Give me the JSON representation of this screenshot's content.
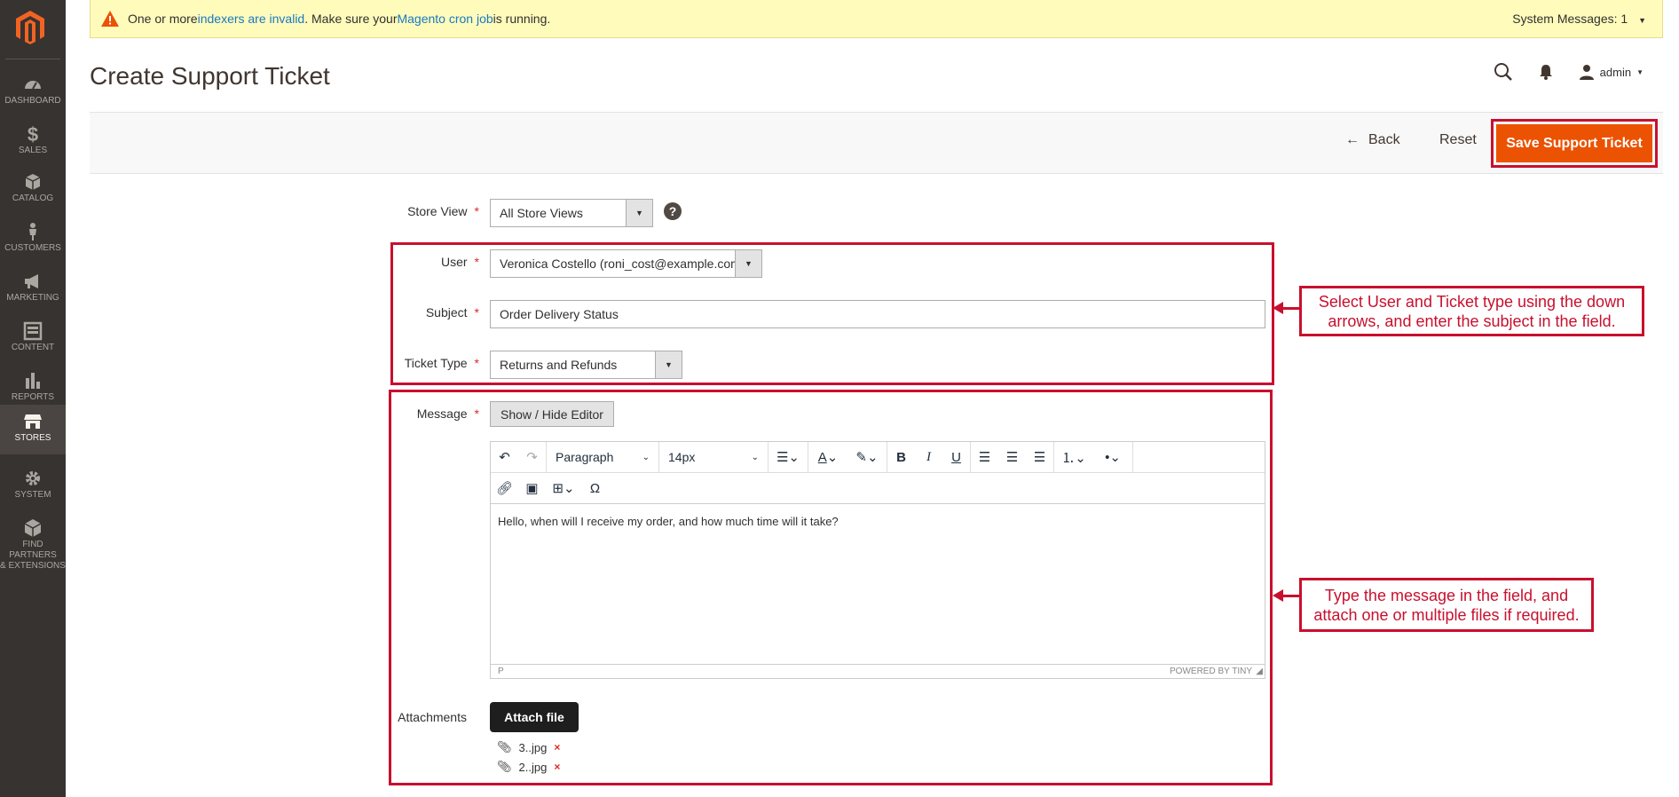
{
  "sidebar": {
    "items": [
      {
        "label": "DASHBOARD",
        "icon": "dashboard-icon"
      },
      {
        "label": "SALES",
        "icon": "dollar-icon"
      },
      {
        "label": "CATALOG",
        "icon": "box-icon"
      },
      {
        "label": "CUSTOMERS",
        "icon": "person-icon"
      },
      {
        "label": "MARKETING",
        "icon": "megaphone-icon"
      },
      {
        "label": "CONTENT",
        "icon": "layout-icon"
      },
      {
        "label": "REPORTS",
        "icon": "bar-chart-icon"
      },
      {
        "label": "STORES",
        "icon": "store-icon"
      },
      {
        "label": "SYSTEM",
        "icon": "gear-icon"
      },
      {
        "label1": "FIND PARTNERS",
        "label2": "& EXTENSIONS",
        "icon": "cube-icon"
      }
    ],
    "active_color": "#4a4542"
  },
  "system_message": {
    "text1": "One or more ",
    "link1": "indexers are invalid",
    "text2": ". Make sure your ",
    "link2": "Magento cron job",
    "text3": " is running.",
    "right": "System Messages: 1"
  },
  "header": {
    "title": "Create Support Ticket",
    "user": "admin"
  },
  "actions": {
    "back": "Back",
    "reset": "Reset",
    "save": "Save Support Ticket"
  },
  "form": {
    "store_view_label": "Store View",
    "store_view_value": "All Store Views",
    "user_label": "User",
    "user_value": "Veronica Costello (roni_cost@example.com)",
    "subject_label": "Subject",
    "subject_value": "Order Delivery Status",
    "ticket_type_label": "Ticket Type",
    "ticket_type_value": "Returns and Refunds",
    "message_label": "Message",
    "show_hide_editor": "Show / Hide Editor",
    "attachments_label": "Attachments",
    "attach_file": "Attach file",
    "files": [
      "3..jpg",
      "2..jpg"
    ]
  },
  "editor": {
    "paragraph": "Paragraph",
    "font_size": "14px",
    "body": "Hello, when will I receive my order, and how much time will it take?",
    "path": "P",
    "powered": "POWERED BY TINY"
  },
  "callouts": {
    "top": "Select User and Ticket type using the down arrows, and enter the subject in the field.",
    "bottom": "Type the message in the field, and attach one or multiple files if required."
  },
  "colors": {
    "accent": "#eb5202",
    "annotation": "#c8102e",
    "sidebar": "#373330"
  }
}
